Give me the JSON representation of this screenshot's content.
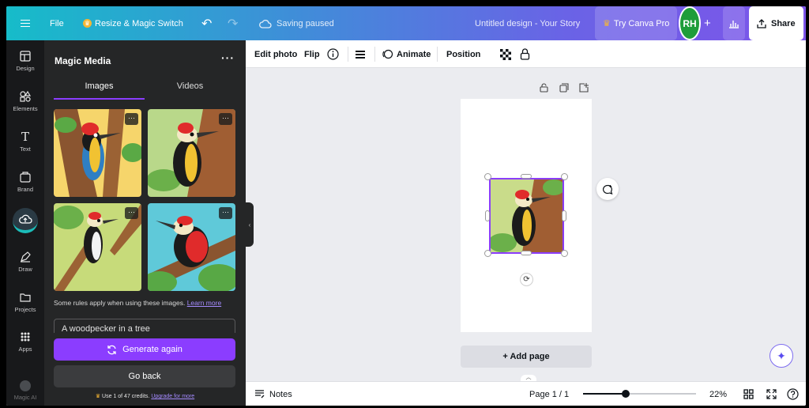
{
  "topbar": {
    "file_label": "File",
    "resize_label": "Resize & Magic Switch",
    "saving_label": "Saving paused",
    "design_title": "Untitled design - Your Story",
    "try_pro_label": "Try Canva Pro",
    "avatar_initials": "RH",
    "share_label": "Share"
  },
  "rail": {
    "items": [
      {
        "label": "Design",
        "icon": "layout-icon"
      },
      {
        "label": "Elements",
        "icon": "shapes-icon"
      },
      {
        "label": "Text",
        "icon": "text-icon"
      },
      {
        "label": "Brand",
        "icon": "brand-icon"
      },
      {
        "label": "Draw",
        "icon": "pen-icon"
      },
      {
        "label": "Projects",
        "icon": "folder-icon"
      },
      {
        "label": "Apps",
        "icon": "apps-grid-icon"
      },
      {
        "label": "Magic AI",
        "icon": "magic-ai-icon"
      }
    ]
  },
  "panel": {
    "title": "Magic Media",
    "tabs": [
      "Images",
      "Videos"
    ],
    "active_tab": "Images",
    "note_text": "Some rules apply when using these images.",
    "note_link": "Learn more",
    "prompt_value": "A woodpecker in a tree",
    "generate_again_label": "Generate again",
    "go_back_label": "Go back",
    "credits_text": "Use 1 of 47 credits.",
    "credits_link": "Upgrade for more"
  },
  "context_toolbar": {
    "edit_photo": "Edit photo",
    "flip": "Flip",
    "animate": "Animate",
    "position": "Position"
  },
  "canvas": {
    "add_page_label": "+ Add page"
  },
  "bottombar": {
    "notes_label": "Notes",
    "page_indicator": "Page 1 / 1",
    "zoom_percent": 22,
    "zoom_label": "22%"
  },
  "colors": {
    "accent": "#8b3dff",
    "panel_bg": "#252627",
    "rail_bg": "#18191b",
    "canvas_bg": "#ebecf0"
  }
}
